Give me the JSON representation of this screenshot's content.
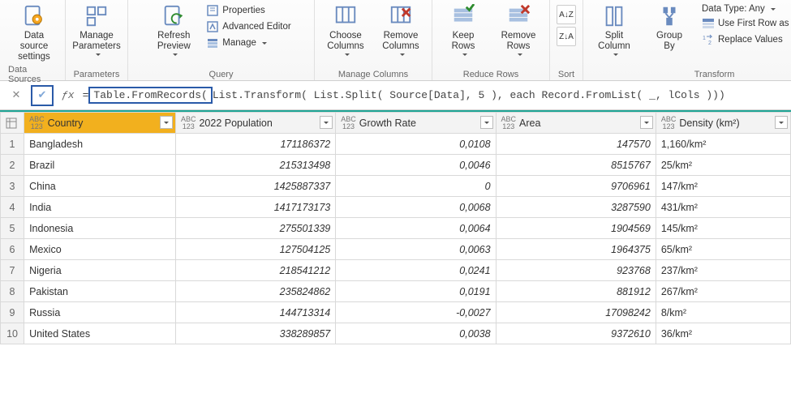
{
  "ribbon": {
    "data_source_settings": "Data source\nsettings",
    "manage_parameters": "Manage\nParameters",
    "refresh_preview": "Refresh\nPreview",
    "properties": "Properties",
    "advanced_editor": "Advanced Editor",
    "manage": "Manage",
    "choose_columns": "Choose\nColumns",
    "remove_columns": "Remove\nColumns",
    "keep_rows": "Keep\nRows",
    "remove_rows": "Remove\nRows",
    "split_column": "Split\nColumn",
    "group_by": "Group\nBy",
    "data_type": "Data Type: Any",
    "first_row_headers": "Use First Row as Headers",
    "replace_values": "Replace Values",
    "group_labels": {
      "data_sources": "Data Sources",
      "parameters": "Parameters",
      "query": "Query",
      "manage_columns": "Manage Columns",
      "reduce_rows": "Reduce Rows",
      "sort": "Sort",
      "transform": "Transform"
    },
    "sort_az": "A↓Z",
    "sort_za": "Z↓A"
  },
  "formula": {
    "prefix": "= ",
    "boxed": "Table.FromRecords(",
    "rest": " List.Transform( List.Split( Source[Data], 5 ), each Record.FromList( _, lCols )))"
  },
  "columns": [
    {
      "name": "Country",
      "type": "ABC123"
    },
    {
      "name": "2022 Population",
      "type": "ABC123"
    },
    {
      "name": "Growth Rate",
      "type": "ABC123"
    },
    {
      "name": "Area",
      "type": "ABC123"
    },
    {
      "name": "Density (km²)",
      "type": "ABC123"
    }
  ],
  "rows": [
    {
      "Country": "Bangladesh",
      "2022 Population": "171186372",
      "Growth Rate": "0,0108",
      "Area": "147570",
      "Density (km²)": "1,160/km²"
    },
    {
      "Country": "Brazil",
      "2022 Population": "215313498",
      "Growth Rate": "0,0046",
      "Area": "8515767",
      "Density (km²)": "25/km²"
    },
    {
      "Country": "China",
      "2022 Population": "1425887337",
      "Growth Rate": "0",
      "Area": "9706961",
      "Density (km²)": "147/km²"
    },
    {
      "Country": "India",
      "2022 Population": "1417173173",
      "Growth Rate": "0,0068",
      "Area": "3287590",
      "Density (km²)": "431/km²"
    },
    {
      "Country": "Indonesia",
      "2022 Population": "275501339",
      "Growth Rate": "0,0064",
      "Area": "1904569",
      "Density (km²)": "145/km²"
    },
    {
      "Country": "Mexico",
      "2022 Population": "127504125",
      "Growth Rate": "0,0063",
      "Area": "1964375",
      "Density (km²)": "65/km²"
    },
    {
      "Country": "Nigeria",
      "2022 Population": "218541212",
      "Growth Rate": "0,0241",
      "Area": "923768",
      "Density (km²)": "237/km²"
    },
    {
      "Country": "Pakistan",
      "2022 Population": "235824862",
      "Growth Rate": "0,0191",
      "Area": "881912",
      "Density (km²)": "267/km²"
    },
    {
      "Country": "Russia",
      "2022 Population": "144713314",
      "Growth Rate": "-0,0027",
      "Area": "17098242",
      "Density (km²)": "8/km²"
    },
    {
      "Country": "United States",
      "2022 Population": "338289857",
      "Growth Rate": "0,0038",
      "Area": "9372610",
      "Density (km²)": "36/km²"
    }
  ]
}
